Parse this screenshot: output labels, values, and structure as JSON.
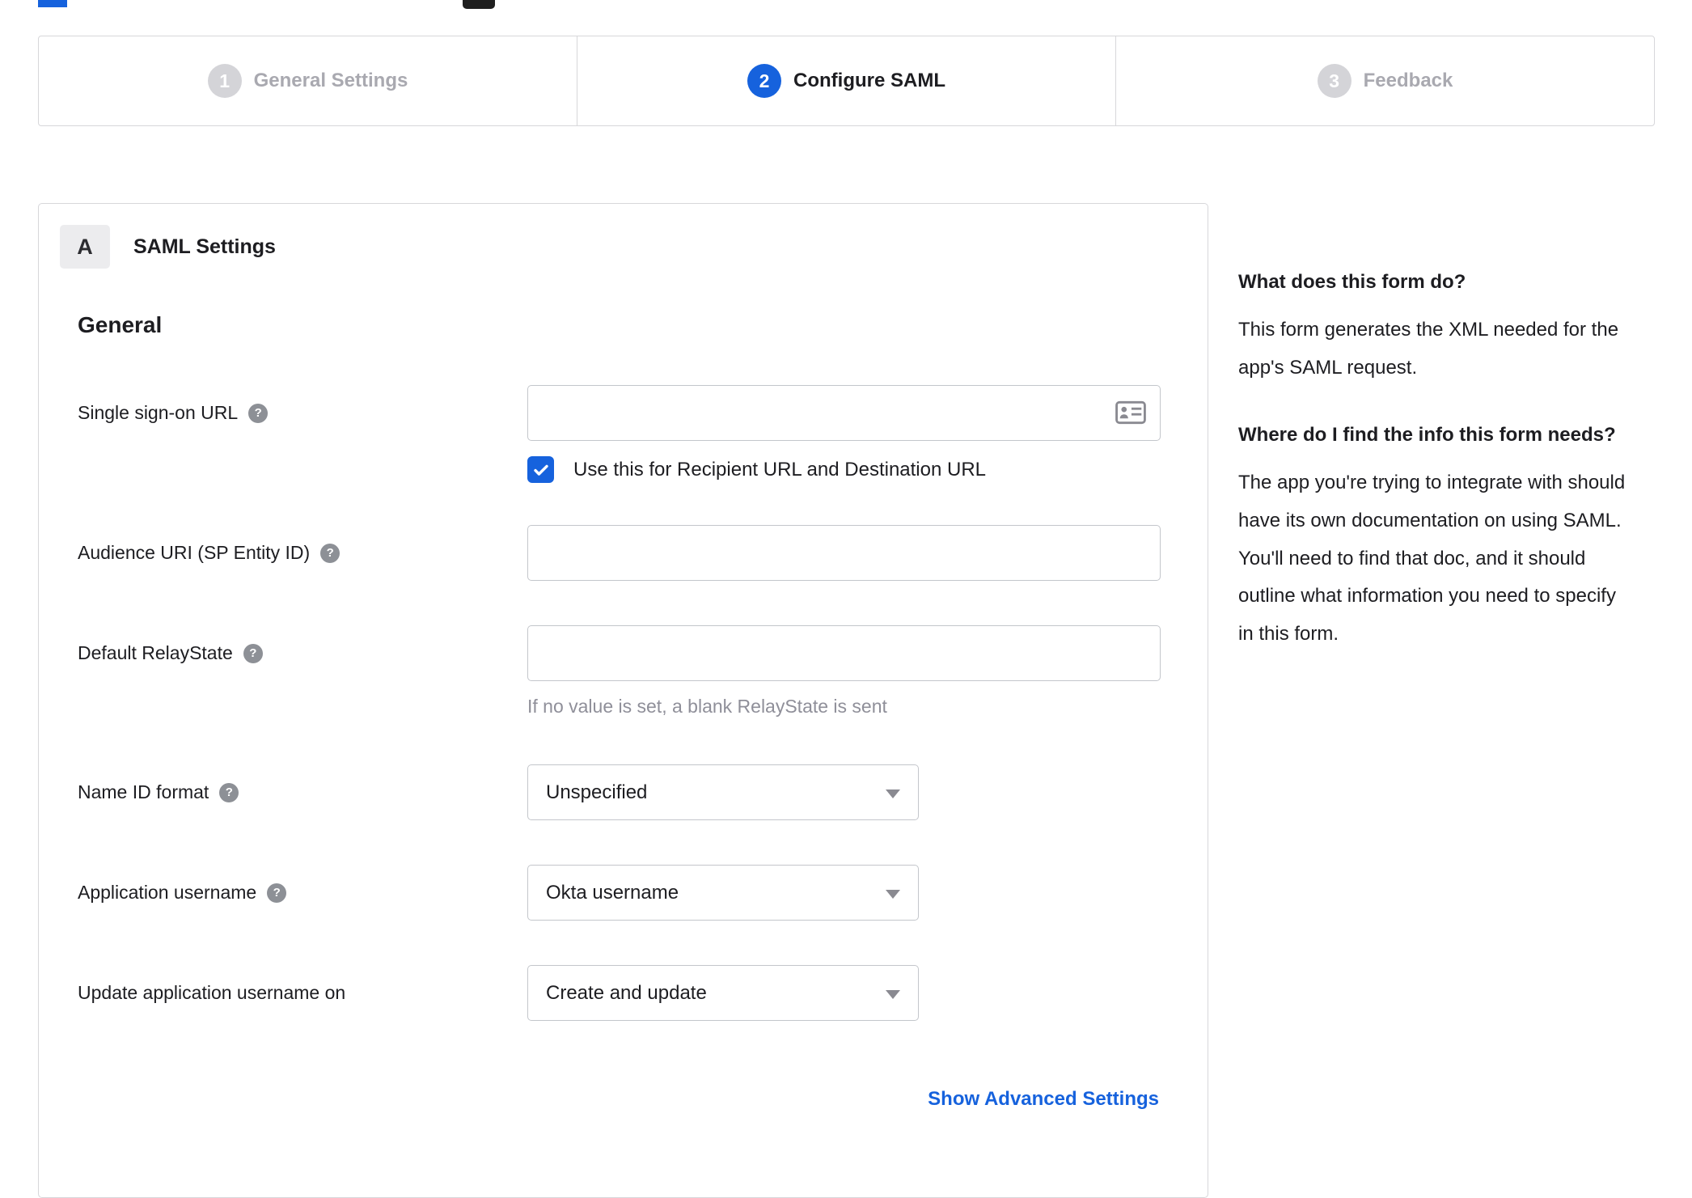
{
  "stepper": {
    "steps": [
      {
        "number": "1",
        "label": "General Settings",
        "state": "inactive"
      },
      {
        "number": "2",
        "label": "Configure SAML",
        "state": "active"
      },
      {
        "number": "3",
        "label": "Feedback",
        "state": "inactive"
      }
    ]
  },
  "panel": {
    "badge": "A",
    "title": "SAML Settings",
    "section_heading": "General",
    "advanced_link": "Show Advanced Settings"
  },
  "form": {
    "sso_url": {
      "label": "Single sign-on URL",
      "value": "",
      "checkbox_label": "Use this for Recipient URL and Destination URL",
      "checkbox_checked": true
    },
    "audience_uri": {
      "label": "Audience URI (SP Entity ID)",
      "value": ""
    },
    "default_relaystate": {
      "label": "Default RelayState",
      "value": "",
      "hint": "If no value is set, a blank RelayState is sent"
    },
    "name_id_format": {
      "label": "Name ID format",
      "selected": "Unspecified"
    },
    "application_username": {
      "label": "Application username",
      "selected": "Okta username"
    },
    "update_application_username_on": {
      "label": "Update application username on",
      "selected": "Create and update"
    }
  },
  "sidebar": {
    "heading_1": "What does this form do?",
    "paragraph_1": "This form generates the XML needed for the app's SAML request.",
    "heading_2": "Where do I find the info this form needs?",
    "paragraph_2": "The app you're trying to integrate with should have its own documentation on using SAML. You'll need to find that doc, and it should outline what information you need to specify in this form."
  },
  "icons": {
    "help_glyph": "?"
  },
  "colors": {
    "accent_blue": "#1662dd",
    "border_gray": "#d7d7da",
    "inactive_gray": "#a9a9b0",
    "hint_gray": "#8f8f99"
  }
}
